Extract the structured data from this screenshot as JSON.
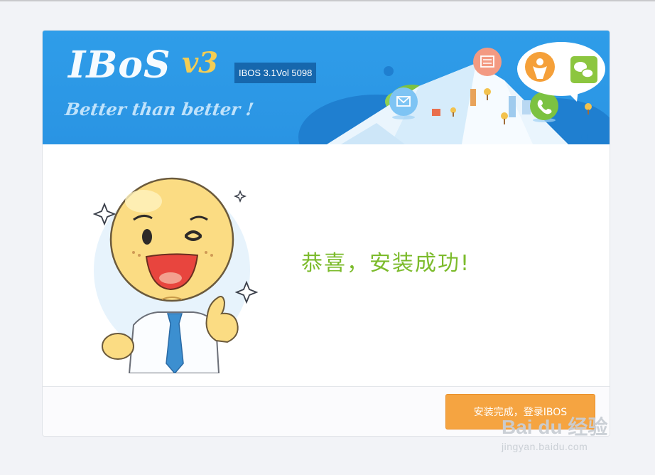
{
  "banner": {
    "logo": "IBoS",
    "logo_version": "v3",
    "tagline": "Better than better !",
    "version_badge": "IBOS 3.1Vol 5098"
  },
  "main": {
    "message": "恭喜，安装成功!"
  },
  "footer": {
    "finish_button": "安装完成，登录IBOS"
  },
  "watermark": {
    "brand": "Bai du 经验",
    "url": "jingyan.baidu.com"
  },
  "colors": {
    "banner_blue": "#2f9de9",
    "success_green": "#7cbb2c",
    "button_orange": "#f5a441"
  },
  "icons": [
    "mail-icon",
    "newspaper-icon",
    "phone-icon",
    "company-logo-icon",
    "wechat-icon",
    "sparkle-icon"
  ]
}
